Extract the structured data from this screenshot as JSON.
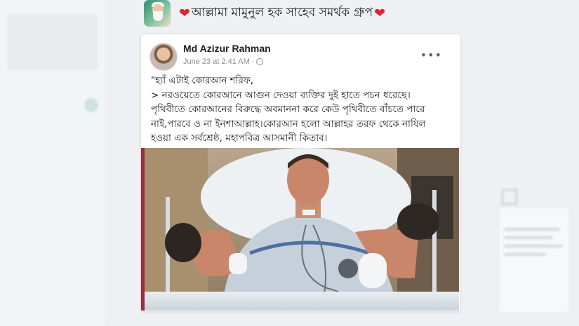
{
  "group": {
    "title": "আল্লামা মামুনুল হক সাহেব সমর্থক গ্রুপ",
    "heart": "❤"
  },
  "post": {
    "author": "Md Azizur Rahman",
    "date": "June 23 at 2:41 AM",
    "meta_separator": "·",
    "more": "•••",
    "lines": [
      "\"হ্যাঁ এটাই কোরআন শরিফ,",
      "> নরওয়েতে কোরআনে আগুন দেওয়া ব্যক্তির দুই হাতে পচন ধরেছে।",
      "পৃথিবীতে কোরআনের বিরুদ্ধে অবমাননা করে কেউ পৃথিবীতে বাঁচতে পারে",
      "নাই,পারবে ও না ইনশাআল্লাহ।কোরআন হলো আল্লাহর তরফ থেকে নাযিল",
      "হওয়া এক সর্বশ্রেষ্ঠ, মহাপবিত্র আসমানী কিতাব।"
    ]
  },
  "colors": {
    "heart": "#e0242f",
    "strip": "#9e2a3a"
  }
}
